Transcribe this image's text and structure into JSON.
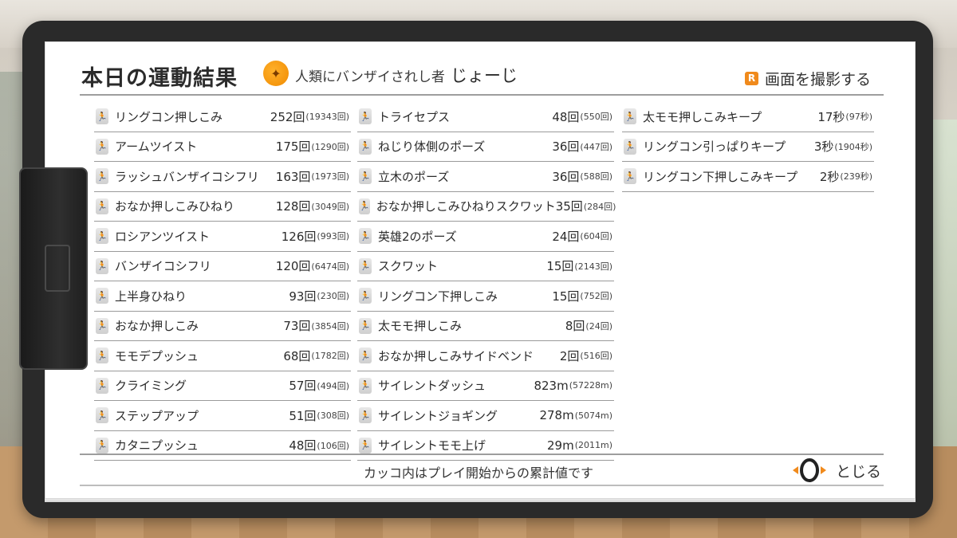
{
  "header": {
    "title": "本日の運動結果",
    "subtitle": "人類にバンザイされし者",
    "player_name": "じょーじ",
    "screenshot_label": "画面を撮影する",
    "screenshot_key": "R"
  },
  "columns": [
    [
      {
        "name": "リングコン押しこみ",
        "count": "252回",
        "total": "(19343回)"
      },
      {
        "name": "アームツイスト",
        "count": "175回",
        "total": "(1290回)"
      },
      {
        "name": "ラッシュバンザイコシフリ",
        "count": "163回",
        "total": "(1973回)"
      },
      {
        "name": "おなか押しこみひねり",
        "count": "128回",
        "total": "(3049回)"
      },
      {
        "name": "ロシアンツイスト",
        "count": "126回",
        "total": "(993回)"
      },
      {
        "name": "バンザイコシフリ",
        "count": "120回",
        "total": "(6474回)"
      },
      {
        "name": "上半身ひねり",
        "count": "93回",
        "total": "(230回)"
      },
      {
        "name": "おなか押しこみ",
        "count": "73回",
        "total": "(3854回)"
      },
      {
        "name": "モモデプッシュ",
        "count": "68回",
        "total": "(1782回)"
      },
      {
        "name": "クライミング",
        "count": "57回",
        "total": "(494回)"
      },
      {
        "name": "ステップアップ",
        "count": "51回",
        "total": "(308回)"
      },
      {
        "name": "カタニプッシュ",
        "count": "48回",
        "total": "(106回)"
      }
    ],
    [
      {
        "name": "トライセプス",
        "count": "48回",
        "total": "(550回)"
      },
      {
        "name": "ねじり体側のポーズ",
        "count": "36回",
        "total": "(447回)"
      },
      {
        "name": "立木のポーズ",
        "count": "36回",
        "total": "(588回)"
      },
      {
        "name": "おなか押しこみひねりスクワット",
        "count": "35回",
        "total": "(284回)"
      },
      {
        "name": "英雄2のポーズ",
        "count": "24回",
        "total": "(604回)"
      },
      {
        "name": "スクワット",
        "count": "15回",
        "total": "(2143回)"
      },
      {
        "name": "リングコン下押しこみ",
        "count": "15回",
        "total": "(752回)"
      },
      {
        "name": "太モモ押しこみ",
        "count": "8回",
        "total": "(24回)"
      },
      {
        "name": "おなか押しこみサイドベンド",
        "count": "2回",
        "total": "(516回)"
      },
      {
        "name": "サイレントダッシュ",
        "count": "823m",
        "total": "(57228m)"
      },
      {
        "name": "サイレントジョギング",
        "count": "278m",
        "total": "(5074m)"
      },
      {
        "name": "サイレントモモ上げ",
        "count": "29m",
        "total": "(2011m)"
      }
    ],
    [
      {
        "name": "太モモ押しこみキープ",
        "count": "17秒",
        "total": "(97秒)"
      },
      {
        "name": "リングコン引っぱりキープ",
        "count": "3秒",
        "total": "(1904秒)"
      },
      {
        "name": "リングコン下押しこみキープ",
        "count": "2秒",
        "total": "(239秒)"
      }
    ]
  ],
  "footer": {
    "note": "カッコ内はプレイ開始からの累計値です",
    "close_label": "とじる"
  },
  "colors": {
    "accent": "#f08a1c",
    "board": "#2a2a2a",
    "paper": "#ffffff"
  }
}
